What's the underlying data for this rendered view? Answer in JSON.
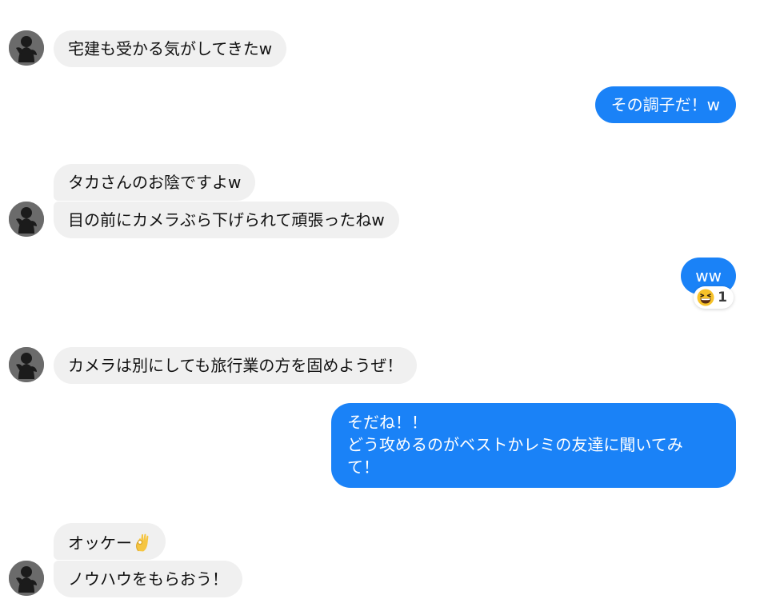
{
  "messages": [
    {
      "id": "m1",
      "text": "宅建も受かる気がしてきたw"
    },
    {
      "id": "m2",
      "text": "その調子だ！w"
    },
    {
      "id": "m3",
      "text": "タカさんのお陰ですよw"
    },
    {
      "id": "m4",
      "text": "目の前にカメラぶら下げられて頑張ったねw"
    },
    {
      "id": "m5",
      "text": "ww",
      "reaction": {
        "emoji": "grinning-squinting-face",
        "count": "1"
      }
    },
    {
      "id": "m6",
      "text": "カメラは別にしても旅行業の方を固めようぜ！"
    },
    {
      "id": "m7",
      "lines": [
        "そだね！！",
        "どう攻めるのがベストかレミの友達に聞いてみ",
        "て！"
      ]
    },
    {
      "id": "m8",
      "text": "オッケー",
      "emoji": "ok-hand"
    },
    {
      "id": "m9",
      "text": "ノウハウをもらおう！"
    }
  ],
  "colors": {
    "outgoing_bubble": "#1a82f7",
    "incoming_bubble": "#f0f0f0",
    "incoming_text": "#111111",
    "outgoing_text": "#ffffff"
  },
  "icons": {
    "avatar": "silhouette-avatar-icon",
    "reaction": "grinning-squinting-face-icon",
    "ok_hand": "ok-hand-icon"
  }
}
